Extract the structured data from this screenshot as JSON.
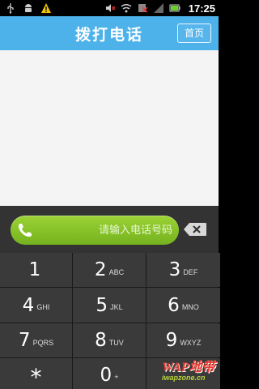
{
  "status_bar": {
    "time": "17:25",
    "left_icons": [
      "usb-icon",
      "android-debug-icon",
      "warning-icon"
    ],
    "right_icons": [
      "mute-icon",
      "wifi-icon",
      "no-sim-icon",
      "signal-icon",
      "battery-icon"
    ]
  },
  "header": {
    "title": "拨打电话",
    "home_label": "首页",
    "color": "#4db2ea"
  },
  "dialer": {
    "placeholder": "请输入电话号码",
    "accent": "#8cc63f",
    "keys": [
      {
        "digit": "1",
        "letters": ""
      },
      {
        "digit": "2",
        "letters": "ABC"
      },
      {
        "digit": "3",
        "letters": "DEF"
      },
      {
        "digit": "4",
        "letters": "GHI"
      },
      {
        "digit": "5",
        "letters": "JKL"
      },
      {
        "digit": "6",
        "letters": "MNO"
      },
      {
        "digit": "7",
        "letters": "PQRS"
      },
      {
        "digit": "8",
        "letters": "TUV"
      },
      {
        "digit": "9",
        "letters": "WXYZ"
      },
      {
        "digit": "*",
        "letters": ""
      },
      {
        "digit": "0",
        "letters": "+"
      },
      {
        "digit": "",
        "letters": ""
      }
    ]
  },
  "watermark": {
    "line1": "WAP地带",
    "line2": "iwapzone.cn"
  }
}
